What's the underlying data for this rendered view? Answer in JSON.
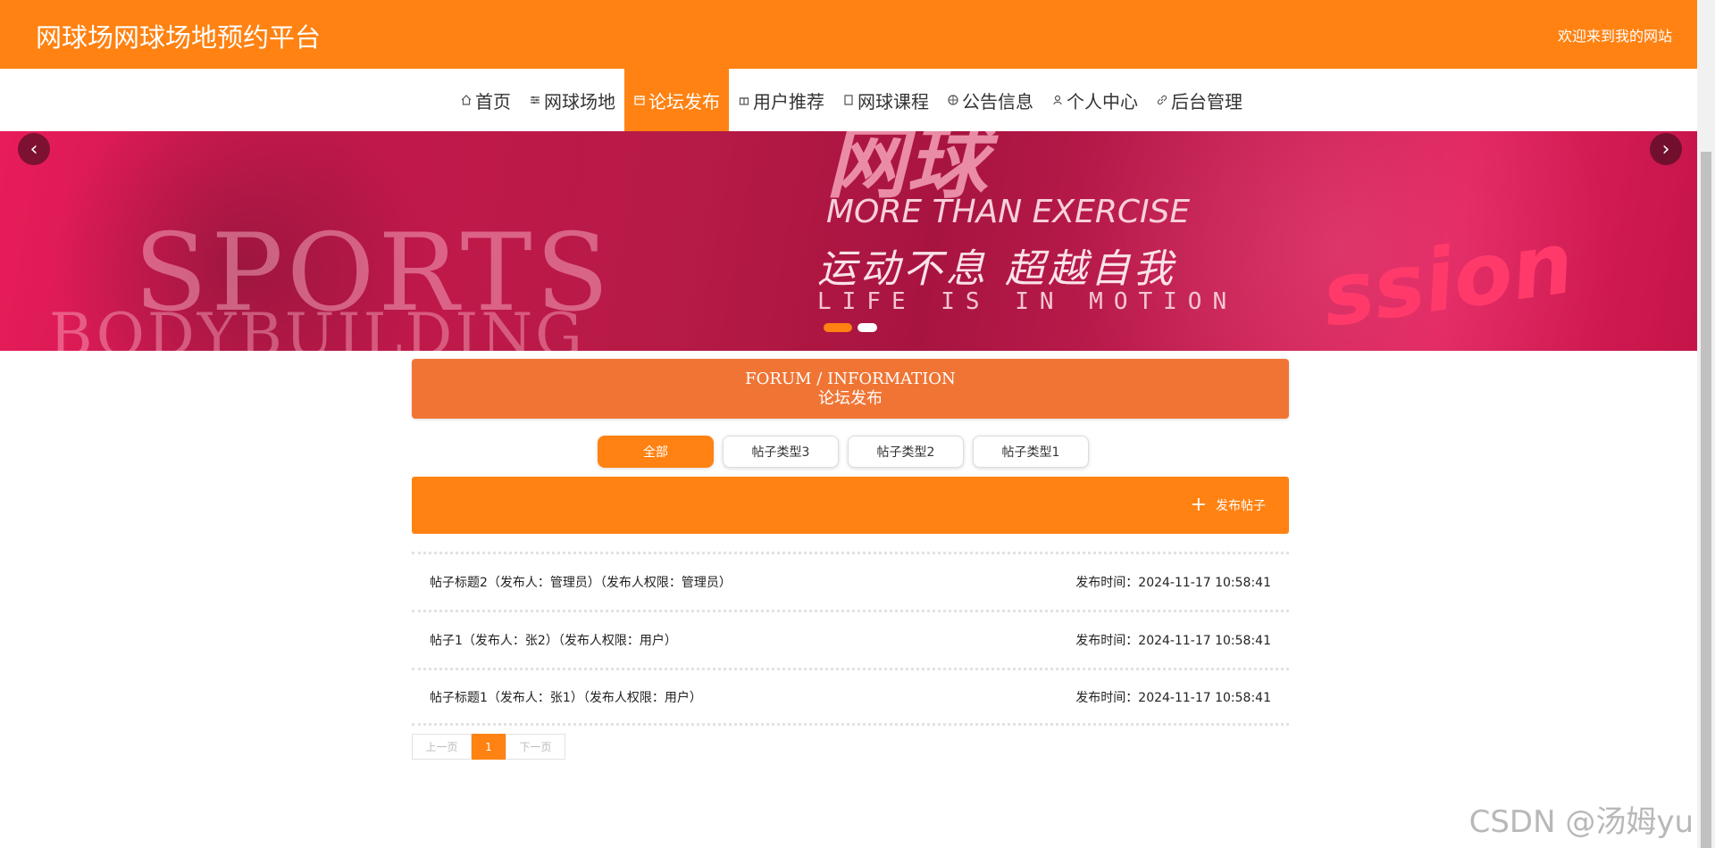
{
  "header": {
    "title": "网球场网球场地预约平台",
    "welcome": "欢迎来到我的网站"
  },
  "nav": {
    "items": [
      {
        "label": "首页",
        "icon": "home-icon"
      },
      {
        "label": "网球场地",
        "icon": "sliders-icon"
      },
      {
        "label": "论坛发布",
        "icon": "calendar-icon",
        "active": true
      },
      {
        "label": "用户推荐",
        "icon": "gift-icon"
      },
      {
        "label": "网球课程",
        "icon": "file-icon"
      },
      {
        "label": "公告信息",
        "icon": "globe-icon"
      },
      {
        "label": "个人中心",
        "icon": "user-icon"
      },
      {
        "label": "后台管理",
        "icon": "link-icon"
      }
    ]
  },
  "banner": {
    "text_sports": "SPORTS",
    "text_body": "BODYBUILDING",
    "text_cn_big": "网球",
    "text_more": "MORE THAN EXERCISE",
    "text_slogan": "运动不息 超越自我",
    "text_life": "LIFE IS IN MOTION",
    "text_brand": "ssion",
    "prev_label": "‹",
    "next_label": "›"
  },
  "section": {
    "title_en": "FORUM / INFORMATION",
    "title_cn": "论坛发布"
  },
  "filters": [
    "全部",
    "帖子类型3",
    "帖子类型2",
    "帖子类型1"
  ],
  "toolbar": {
    "publish_plus": "+",
    "publish_label": "发布帖子"
  },
  "posts": [
    {
      "title": "帖子标题2（发布人：管理员）（发布人权限：管理员）",
      "time": "发布时间：2024-11-17 10:58:41"
    },
    {
      "title": "帖子1（发布人：张2）（发布人权限：用户）",
      "time": "发布时间：2024-11-17 10:58:41"
    },
    {
      "title": "帖子标题1（发布人：张1）（发布人权限：用户）",
      "time": "发布时间：2024-11-17 10:58:41"
    }
  ],
  "pager": {
    "prev": "上一页",
    "current": "1",
    "next": "下一页"
  },
  "watermark": "CSDN @汤姆yu",
  "colors": {
    "primary": "#ff8212",
    "section_header": "#f07535"
  }
}
